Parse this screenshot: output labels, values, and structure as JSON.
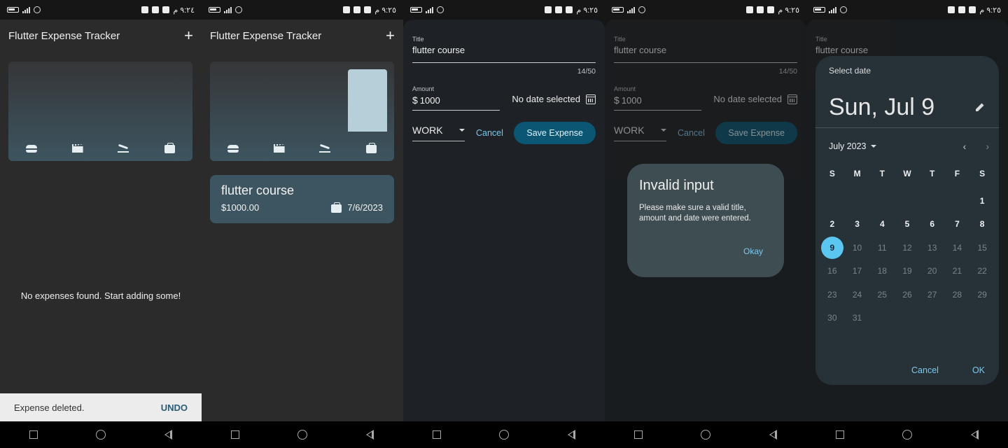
{
  "status": {
    "time1": "٩:٢٤ م",
    "time2": "٩:٢٥ م",
    "time3": "٩:٢٥ م",
    "time4": "٩:٢٥ م",
    "time5": "٩:٢٥ م"
  },
  "appbar": {
    "title": "Flutter Expense Tracker",
    "add": "+"
  },
  "screen1": {
    "empty_text": "No expenses found. Start adding some!",
    "snackbar_text": "Expense deleted.",
    "snackbar_action": "UNDO"
  },
  "screen2": {
    "chart_data": {
      "type": "bar",
      "categories": [
        "food",
        "leisure",
        "travel",
        "work"
      ],
      "values": [
        0,
        0,
        0,
        1000
      ]
    },
    "expense": {
      "title": "flutter course",
      "amount": "$1000.00",
      "date": "7/6/2023",
      "category_icon": "briefcase-icon"
    }
  },
  "form": {
    "title_label": "Title",
    "title_value": "flutter course",
    "counter": "14/50",
    "amount_label": "Amount",
    "amount_prefix": "$",
    "amount_value": "1000",
    "no_date": "No date selected",
    "category": "WORK",
    "cancel": "Cancel",
    "save": "Save Expense"
  },
  "dialog": {
    "title": "Invalid input",
    "body": "Please make sure a valid title, amount and date were entered.",
    "ok": "Okay"
  },
  "picker": {
    "select_date": "Select date",
    "headline": "Sun, Jul 9",
    "month": "July 2023",
    "weekdays": [
      "S",
      "M",
      "T",
      "W",
      "T",
      "F",
      "S"
    ],
    "cancel": "Cancel",
    "ok": "OK"
  }
}
